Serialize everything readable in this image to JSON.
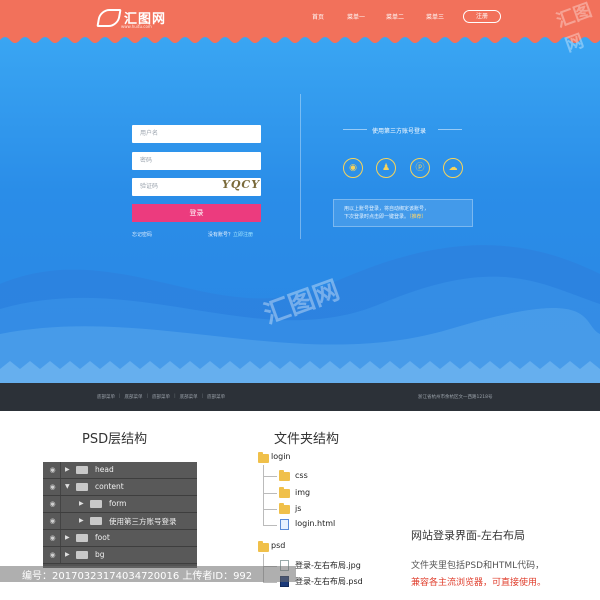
{
  "header": {
    "logo_text": "汇图网",
    "logo_sub": "www.huitu.com",
    "nav_home": "首页",
    "nav_items": [
      "菜单一",
      "菜单二",
      "菜单三"
    ],
    "register_label": "注册"
  },
  "login": {
    "username_placeholder": "用户名",
    "password_placeholder": "密码",
    "code_placeholder": "验证码",
    "captcha_text": "YQCY",
    "login_label": "登录",
    "forgot_label": "忘记密码",
    "no_account_text": "没有账号？",
    "register_now_label": "立即注册"
  },
  "third_party": {
    "title": "使用第三方账号登录",
    "icons": [
      "weibo-icon",
      "qq-icon",
      "alipay-icon",
      "wechat-icon"
    ],
    "bind_text_1": "用以上账号登录，将自动绑定该账号，",
    "bind_text_2": "下次登录时点击即一键登录。",
    "bind_action": "（推荐）"
  },
  "footer": {
    "links": [
      "底部菜单",
      "底部菜单",
      "底部菜单",
      "底部菜单",
      "底部菜单"
    ],
    "address": "浙江省杭州市余杭区文一西路1218号"
  },
  "bottom": {
    "psd_title": "PSD层结构",
    "folder_title": "文件夹结构",
    "layers": [
      {
        "name": "head",
        "expanded": false
      },
      {
        "name": "content",
        "expanded": true
      },
      {
        "name": "form",
        "expanded": false
      },
      {
        "name": "使用第三方账号登录",
        "expanded": false
      },
      {
        "name": "foot",
        "expanded": false
      },
      {
        "name": "bg",
        "expanded": false
      }
    ],
    "tree": {
      "root": "login",
      "children": [
        "css",
        "img",
        "js",
        "login.html"
      ],
      "psd_folder": "psd",
      "psd_files": [
        "登录-左右布局.jpg",
        "登录-左右布局.psd"
      ]
    },
    "desc_title": "网站登录界面-左右布局",
    "desc_line1": "文件夹里包括PSD和HTML代码，",
    "desc_line2": "兼容各主流浏览器，可直接使用。"
  },
  "watermark": {
    "text": "编号：20170323174034720016 上传者ID：992",
    "logo": "汇图网",
    "sub": "huitu.com"
  },
  "colors": {
    "topbar": "#f2715b",
    "hero": "#2a8de8",
    "login_button": "#ec3b7e",
    "footer": "#2c3138",
    "icon_ring": "#f7d35a"
  }
}
